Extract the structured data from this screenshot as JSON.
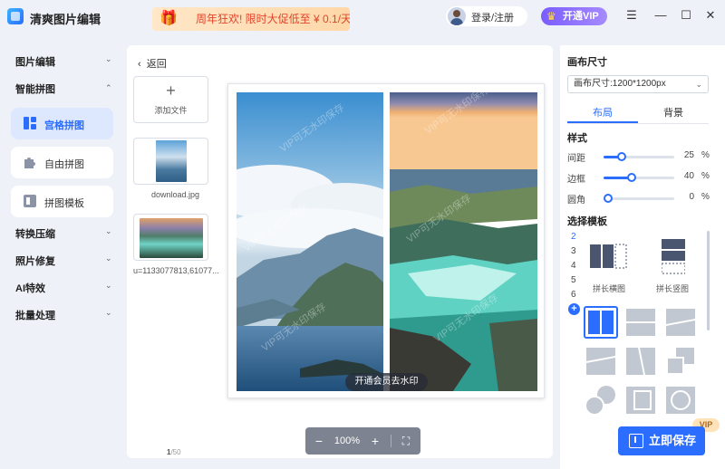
{
  "app": {
    "title": "清爽图片编辑"
  },
  "promo": {
    "text": "周年狂欢! 限时大促低至 ¥ 0.1/天"
  },
  "header": {
    "login": "登录/注册",
    "vip": "开通VIP"
  },
  "sidebar": {
    "groups": [
      {
        "label": "图片编辑"
      },
      {
        "label": "智能拼图"
      },
      {
        "label": "转换压缩"
      },
      {
        "label": "照片修复"
      },
      {
        "label": "AI特效"
      },
      {
        "label": "批量处理"
      }
    ],
    "items": [
      {
        "label": "宫格拼图",
        "active": true
      },
      {
        "label": "自由拼图",
        "active": false
      },
      {
        "label": "拼图模板",
        "active": false
      }
    ]
  },
  "main": {
    "back": "返回",
    "add_file": "添加文件",
    "files": [
      {
        "name": "download.jpg"
      },
      {
        "name": "u=1133077813,61077..."
      }
    ],
    "page_current": "1",
    "page_total": "/50",
    "watermark_pill": "开通会员去水印",
    "watermark_text": "VIP可无水印保存"
  },
  "zoom": {
    "value": "100%"
  },
  "right": {
    "canvas_size_title": "画布尺寸",
    "canvas_size_value": "画布尺寸:1200*1200px",
    "tabs": [
      {
        "label": "布局",
        "active": true
      },
      {
        "label": "背景",
        "active": false
      }
    ],
    "style_title": "样式",
    "sliders": [
      {
        "label": "间距",
        "value": 25,
        "unit": "%"
      },
      {
        "label": "边框",
        "value": 40,
        "unit": "%"
      },
      {
        "label": "圆角",
        "value": 0,
        "unit": "%"
      }
    ],
    "template_title": "选择模板",
    "numbers": [
      "2",
      "3",
      "4",
      "5",
      "6"
    ],
    "templates": [
      {
        "label": "拼长横图"
      },
      {
        "label": "拼长竖图"
      }
    ],
    "save_label": "立即保存",
    "vip_badge": "VIP"
  },
  "colors": {
    "accent": "#2a6dff",
    "vip": "#8a6dff",
    "promo": "#e0452b"
  }
}
